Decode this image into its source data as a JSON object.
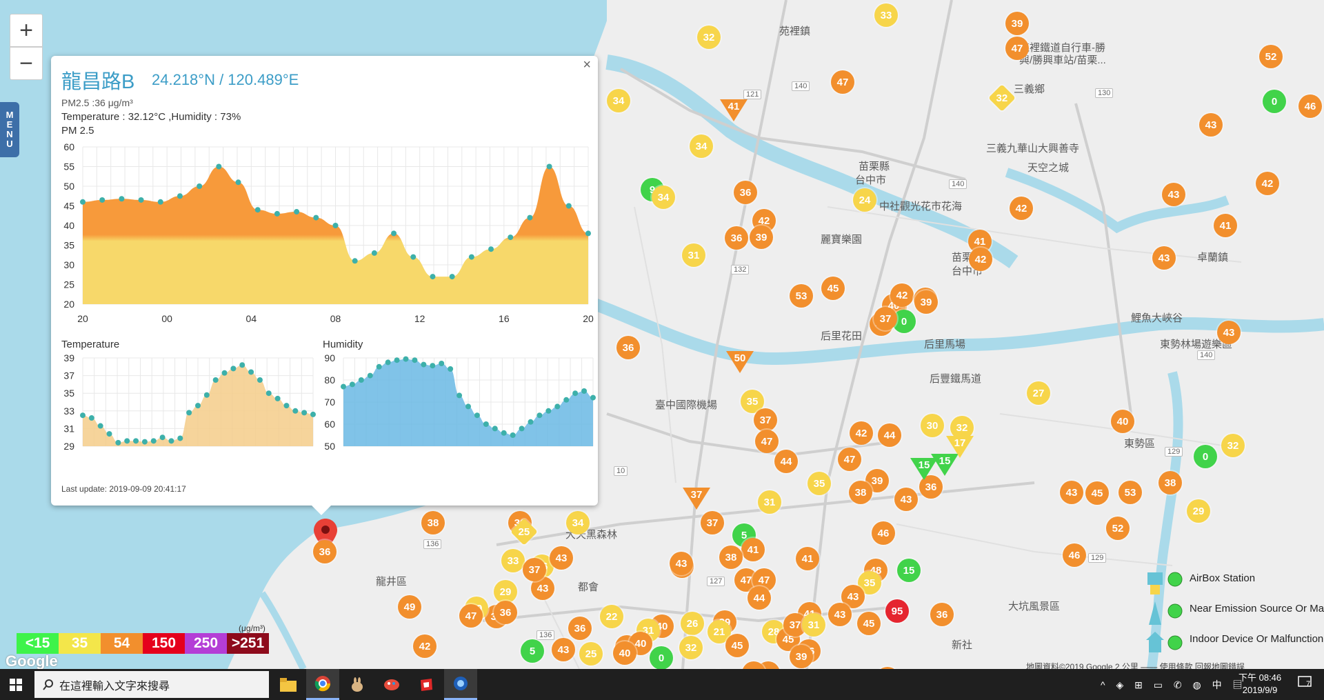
{
  "map": {
    "zoom_in": "+",
    "zoom_out": "−",
    "menu_letters": [
      "M",
      "E",
      "N",
      "U"
    ],
    "place_labels": [
      {
        "text": "苑裡鎮"
      },
      {
        "text": "苑裡鐵道自行車-勝"
      },
      {
        "text": "興/勝興車站/苗栗..."
      },
      {
        "text": "三義鄉"
      },
      {
        "text": "三義九華山大興善寺"
      },
      {
        "text": "天空之城"
      },
      {
        "text": "苗栗縣"
      },
      {
        "text": "台中市"
      },
      {
        "text": "中社觀光花市花海"
      },
      {
        "text": "麗寶樂園"
      },
      {
        "text": "后里花田"
      },
      {
        "text": "后里馬場"
      },
      {
        "text": "后豐鐵馬道"
      },
      {
        "text": "臺中國際機場"
      },
      {
        "text": "卓蘭鎮"
      },
      {
        "text": "東勢區"
      },
      {
        "text": "大坑風景區"
      },
      {
        "text": "龍井區"
      },
      {
        "text": "東勢林場遊樂區"
      },
      {
        "text": "鯉魚大峽谷"
      },
      {
        "text": "大天黑森林"
      },
      {
        "text": "都會"
      },
      {
        "text": "苗栗縣"
      },
      {
        "text": "台中市"
      },
      {
        "text": "新社"
      }
    ],
    "markers": [
      {
        "v": "33",
        "c": "#f7d54a"
      },
      {
        "v": "39",
        "c": "#f28f2d"
      },
      {
        "v": "47",
        "c": "#f28f2d"
      },
      {
        "v": "32",
        "c": "#f7d54a"
      },
      {
        "v": "52",
        "c": "#f28f2d"
      },
      {
        "v": "0",
        "c": "#41d34a"
      },
      {
        "v": "46",
        "c": "#f28f2d"
      },
      {
        "v": "34",
        "c": "#f7d54a"
      },
      {
        "v": "47",
        "c": "#f28f2d"
      },
      {
        "v": "43",
        "c": "#f28f2d"
      },
      {
        "v": "41",
        "c": "#f28f2d"
      },
      {
        "v": "34",
        "c": "#f7d54a"
      },
      {
        "v": "9",
        "c": "#41d34a"
      },
      {
        "v": "34",
        "c": "#f7d54a"
      },
      {
        "v": "36",
        "c": "#f28f2d"
      },
      {
        "v": "24",
        "c": "#f7d54a"
      },
      {
        "v": "42",
        "c": "#f28f2d"
      },
      {
        "v": "43",
        "c": "#f28f2d"
      },
      {
        "v": "42",
        "c": "#f28f2d"
      },
      {
        "v": "41",
        "c": "#f28f2d"
      },
      {
        "v": "36",
        "c": "#f28f2d"
      },
      {
        "v": "39",
        "c": "#f28f2d"
      },
      {
        "v": "42",
        "c": "#f28f2d"
      },
      {
        "v": "31",
        "c": "#f7d54a"
      },
      {
        "v": "42",
        "c": "#f28f2d"
      },
      {
        "v": "43",
        "c": "#f28f2d"
      },
      {
        "v": "53",
        "c": "#f28f2d"
      },
      {
        "v": "45",
        "c": "#f28f2d"
      },
      {
        "v": "49",
        "c": "#f28f2d"
      },
      {
        "v": "40",
        "c": "#f28f2d"
      },
      {
        "v": "42",
        "c": "#f28f2d"
      },
      {
        "v": "39",
        "c": "#f28f2d"
      },
      {
        "v": "41",
        "c": "#f28f2d"
      },
      {
        "v": "0",
        "c": "#41d34a"
      },
      {
        "v": "37",
        "c": "#f28f2d"
      },
      {
        "v": "39",
        "c": "#f28f2d"
      },
      {
        "v": "43",
        "c": "#f28f2d"
      },
      {
        "v": "27",
        "c": "#f7d54a"
      },
      {
        "v": "36",
        "c": "#f28f2d"
      },
      {
        "v": "35",
        "c": "#f7d54a"
      },
      {
        "v": "37",
        "c": "#f28f2d"
      },
      {
        "v": "47",
        "c": "#f28f2d"
      },
      {
        "v": "30",
        "c": "#f7d54a"
      },
      {
        "v": "42",
        "c": "#f28f2d"
      },
      {
        "v": "44",
        "c": "#f28f2d"
      },
      {
        "v": "32",
        "c": "#f7d54a"
      },
      {
        "v": "40",
        "c": "#f28f2d"
      },
      {
        "v": "0",
        "c": "#41d34a"
      },
      {
        "v": "32",
        "c": "#f7d54a"
      },
      {
        "v": "44",
        "c": "#f28f2d"
      },
      {
        "v": "47",
        "c": "#f28f2d"
      },
      {
        "v": "35",
        "c": "#f7d54a"
      },
      {
        "v": "39",
        "c": "#f28f2d"
      },
      {
        "v": "38",
        "c": "#f28f2d"
      },
      {
        "v": "43",
        "c": "#f28f2d"
      },
      {
        "v": "36",
        "c": "#f28f2d"
      },
      {
        "v": "43",
        "c": "#f28f2d"
      },
      {
        "v": "45",
        "c": "#f28f2d"
      },
      {
        "v": "53",
        "c": "#f28f2d"
      },
      {
        "v": "38",
        "c": "#f28f2d"
      },
      {
        "v": "29",
        "c": "#f7d54a"
      },
      {
        "v": "52",
        "c": "#f28f2d"
      },
      {
        "v": "46",
        "c": "#f28f2d"
      },
      {
        "v": "31",
        "c": "#f7d54a"
      },
      {
        "v": "37",
        "c": "#f28f2d"
      },
      {
        "v": "5",
        "c": "#41d34a"
      },
      {
        "v": "41",
        "c": "#f28f2d"
      },
      {
        "v": "38",
        "c": "#f28f2d"
      },
      {
        "v": "47",
        "c": "#f28f2d"
      },
      {
        "v": "47",
        "c": "#f28f2d"
      },
      {
        "v": "44",
        "c": "#f28f2d"
      },
      {
        "v": "43",
        "c": "#f28f2d"
      },
      {
        "v": "41",
        "c": "#f28f2d"
      },
      {
        "v": "46",
        "c": "#f28f2d"
      },
      {
        "v": "48",
        "c": "#f28f2d"
      },
      {
        "v": "15",
        "c": "#41d34a"
      },
      {
        "v": "35",
        "c": "#f7d54a"
      },
      {
        "v": "43",
        "c": "#f28f2d"
      },
      {
        "v": "95",
        "c": "#e5252f"
      },
      {
        "v": "45",
        "c": "#f28f2d"
      },
      {
        "v": "41",
        "c": "#f28f2d"
      },
      {
        "v": "43",
        "c": "#f28f2d"
      },
      {
        "v": "44",
        "c": "#f28f2d"
      },
      {
        "v": "28",
        "c": "#f7d54a"
      },
      {
        "v": "39",
        "c": "#f28f2d"
      },
      {
        "v": "45",
        "c": "#f28f2d"
      },
      {
        "v": "36",
        "c": "#f28f2d"
      },
      {
        "v": "37",
        "c": "#f28f2d"
      },
      {
        "v": "40",
        "c": "#f28f2d"
      },
      {
        "v": "36",
        "c": "#f28f2d"
      },
      {
        "v": "38",
        "c": "#f28f2d"
      },
      {
        "v": "36",
        "c": "#f28f2d"
      },
      {
        "v": "34",
        "c": "#f7d54a"
      },
      {
        "v": "33",
        "c": "#f7d54a"
      },
      {
        "v": "26",
        "c": "#f7d54a"
      },
      {
        "v": "43",
        "c": "#f28f2d"
      },
      {
        "v": "43",
        "c": "#f28f2d"
      },
      {
        "v": "37",
        "c": "#f28f2d"
      },
      {
        "v": "29",
        "c": "#f7d54a"
      },
      {
        "v": "38",
        "c": "#f28f2d"
      },
      {
        "v": "29",
        "c": "#f7d54a"
      },
      {
        "v": "49",
        "c": "#f28f2d"
      },
      {
        "v": "47",
        "c": "#f28f2d"
      },
      {
        "v": "22",
        "c": "#f7d54a"
      },
      {
        "v": "36",
        "c": "#f28f2d"
      },
      {
        "v": "42",
        "c": "#f28f2d"
      },
      {
        "v": "36",
        "c": "#f28f2d"
      },
      {
        "v": "40",
        "c": "#f28f2d"
      },
      {
        "v": "31",
        "c": "#f7d54a"
      },
      {
        "v": "0",
        "c": "#41d34a"
      },
      {
        "v": "40",
        "c": "#f28f2d"
      },
      {
        "v": "5",
        "c": "#41d34a"
      },
      {
        "v": "43",
        "c": "#f28f2d"
      },
      {
        "v": "25",
        "c": "#f7d54a"
      },
      {
        "v": "26",
        "c": "#f7d54a"
      },
      {
        "v": "21",
        "c": "#f7d54a"
      },
      {
        "v": "39",
        "c": "#f28f2d"
      },
      {
        "v": "45",
        "c": "#f28f2d"
      },
      {
        "v": "32",
        "c": "#f7d54a"
      },
      {
        "v": "37",
        "c": "#f28f2d"
      },
      {
        "v": "36",
        "c": "#f28f2d"
      },
      {
        "v": "36",
        "c": "#f28f2d"
      },
      {
        "v": "37",
        "c": "#f28f2d"
      },
      {
        "v": "31",
        "c": "#f7d54a"
      },
      {
        "v": "40",
        "c": "#f28f2d"
      },
      {
        "v": "36",
        "c": "#f28f2d"
      }
    ],
    "triangles": [
      {
        "v": "41",
        "c": "#f28f2d"
      },
      {
        "v": "50",
        "c": "#f28f2d"
      },
      {
        "v": "37",
        "c": "#f28f2d"
      },
      {
        "v": "15",
        "c": "#41d34a"
      },
      {
        "v": "15",
        "c": "#41d34a"
      },
      {
        "v": "17",
        "c": "#f7d54a"
      }
    ],
    "diamonds": [
      {
        "v": "32",
        "c": "#f7d54a"
      },
      {
        "v": "25",
        "c": "#f7d54a"
      }
    ],
    "road_numbers": [
      "121",
      "140",
      "130",
      "140",
      "132",
      "136",
      "136",
      "127",
      "129",
      "129",
      "140",
      "10"
    ]
  },
  "popup": {
    "title": "龍昌路B",
    "coord": "24.218°N / 120.489°E",
    "pm_line": "PM2.5 :36 μg/m³",
    "temp_line": "Temperature : 32.12°C ,Humidity : 73%",
    "pm_head": "PM 2.5",
    "temp_head": "Temperature",
    "hum_head": "Humidity",
    "updated": "Last update: 2019-09-09 20:41:17",
    "close": "×",
    "pin_value": "36"
  },
  "chart_data": [
    {
      "type": "area",
      "title": "PM 2.5",
      "x": [
        "20",
        "",
        "",
        "",
        "",
        "",
        "",
        "00",
        "",
        "",
        "",
        "",
        "",
        "",
        "",
        "04",
        "",
        "",
        "",
        "",
        "",
        "",
        "",
        "08",
        "",
        "",
        "",
        "",
        "",
        "",
        "",
        "12",
        "",
        "",
        "",
        "",
        "",
        "",
        "",
        "16",
        "",
        "",
        "",
        "",
        "",
        "",
        "",
        "20"
      ],
      "x_ticks": [
        "20",
        "00",
        "04",
        "08",
        "12",
        "16",
        "20"
      ],
      "y": [
        46,
        46.5,
        46.8,
        46.5,
        46,
        47.5,
        50,
        55,
        51,
        44,
        43,
        43.5,
        42,
        40,
        31,
        33,
        38,
        32,
        27,
        27,
        32,
        34,
        37,
        42,
        55,
        45,
        38
      ],
      "ylim": [
        20,
        60
      ],
      "y_ticks": [
        "60",
        "55",
        "50",
        "45",
        "40",
        "35",
        "30",
        "25",
        "20"
      ],
      "colors": {
        "low": "#f7d86a",
        "mid": "#f79a3b",
        "high": "#e5252f"
      }
    },
    {
      "type": "area",
      "title": "Temperature",
      "y": [
        32.5,
        32.2,
        31.3,
        30.4,
        29.4,
        29.6,
        29.6,
        29.5,
        29.6,
        30,
        29.6,
        29.9,
        32.8,
        33.6,
        34.8,
        36.5,
        37.3,
        37.8,
        38.2,
        37.4,
        36.5,
        35,
        34.4,
        33.6,
        33,
        32.8,
        32.6
      ],
      "ylim": [
        29,
        39
      ],
      "y_ticks": [
        "39",
        "37",
        "35",
        "33",
        "31",
        "29"
      ],
      "colors": {
        "fill": "#f5cd8a",
        "line": "#e8b06a"
      }
    },
    {
      "type": "area",
      "title": "Humidity",
      "y": [
        77,
        78,
        80,
        82,
        86,
        88,
        89,
        89.5,
        89,
        87,
        86.5,
        87.5,
        85,
        73,
        68,
        64,
        60,
        58,
        56,
        55,
        58,
        61,
        64,
        66,
        68,
        71,
        74,
        75,
        72
      ],
      "ylim": [
        50,
        90
      ],
      "y_ticks": [
        "90",
        "80",
        "70",
        "60",
        "50"
      ],
      "colors": {
        "fill": "#6ab8e4",
        "line": "#4aa0d8"
      }
    }
  ],
  "legend": {
    "unit": "(μg/m³)",
    "items": [
      {
        "label": "<15",
        "color": "#3ef34a"
      },
      {
        "label": "35",
        "color": "#f3e64a"
      },
      {
        "label": "54",
        "color": "#f28f2d"
      },
      {
        "label": "150",
        "color": "#e5001c"
      },
      {
        "label": "250",
        "color": "#b43dd6"
      },
      {
        "label": ">251",
        "color": "#8e0b1c"
      }
    ]
  },
  "google_logo": "Google",
  "right_legend": [
    {
      "label": "AirBox Station",
      "badge": "20"
    },
    {
      "label": "Near Emission Source Or Malfunction",
      "badge": "20"
    },
    {
      "label": "Indoor Device Or Malfunction",
      "badge": "20"
    }
  ],
  "attribution": "地圖資料©2019 Google   2 公里 ⎯⎯⎯⎯   使用條款   回報地圖錯誤",
  "taskbar": {
    "search_text": "在這裡輸入文字來搜尋",
    "clock_time": "下午 08:46",
    "clock_date": "2019/9/9",
    "tray": "^ ◈ ⊞ ▭ ✆ ◍ 中 ▤",
    "notif": "7"
  }
}
